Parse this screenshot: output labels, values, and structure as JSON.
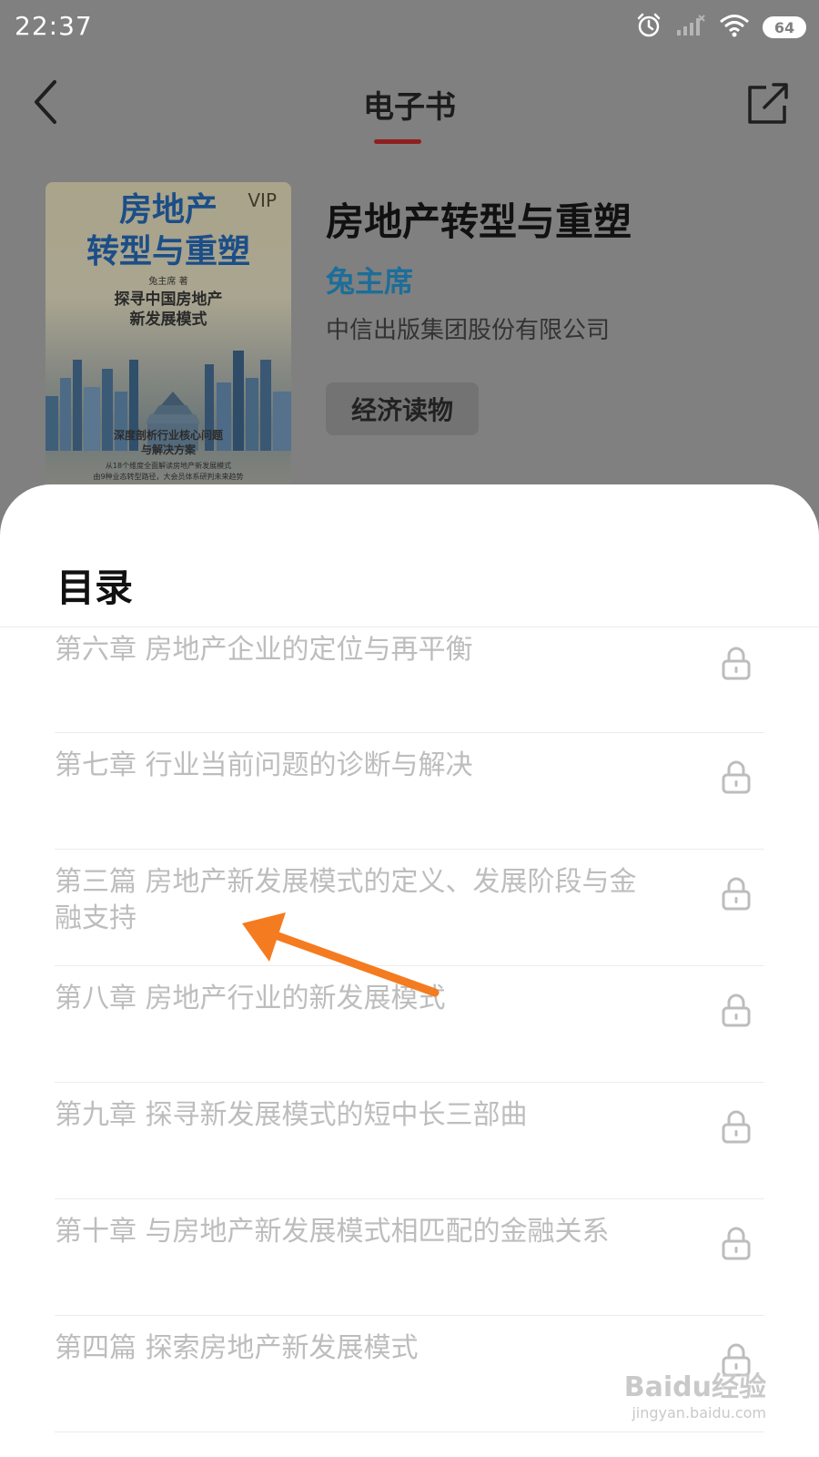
{
  "status_bar": {
    "time": "22:37",
    "battery": "64",
    "icons": [
      "alarm-icon",
      "signal-icon",
      "wifi-icon",
      "battery-icon"
    ]
  },
  "header": {
    "title": "电子书",
    "back_icon": "back-chevron-icon",
    "share_icon": "share-icon",
    "accent_color": "#c62828"
  },
  "book": {
    "cover": {
      "vip": "VIP",
      "title_line1": "房地产",
      "title_line2": "转型与重塑",
      "author": "兔主席 著",
      "subtitle_line1": "探寻中国房地产",
      "subtitle_line2": "新发展模式",
      "note_line1": "深度剖析行业核心问题",
      "note_line2": "与解决方案",
      "note_line3": "从18个维度全面解读房地产新发展模式",
      "note_line4": "由9种业态转型路径，大会员体系研判未来趋势"
    },
    "title": "房地产转型与重塑",
    "author": "兔主席",
    "publisher": "中信出版集团股份有限公司",
    "tag": "经济读物"
  },
  "toc": {
    "title": "目录",
    "items": [
      {
        "label": "第六章 房地产企业的定位与再平衡",
        "locked": true
      },
      {
        "label": "第七章 行业当前问题的诊断与解决",
        "locked": true
      },
      {
        "label": "第三篇 房地产新发展模式的定义、发展阶段与金融支持",
        "locked": true
      },
      {
        "label": "第八章 房地产行业的新发展模式",
        "locked": true
      },
      {
        "label": "第九章 探寻新发展模式的短中长三部曲",
        "locked": true
      },
      {
        "label": "第十章 与房地产新发展模式相匹配的金融关系",
        "locked": true
      },
      {
        "label": "第四篇 探索房地产新发展模式",
        "locked": true
      }
    ]
  },
  "annotation": {
    "type": "arrow",
    "color": "#f47b20"
  },
  "watermark": {
    "brand": "Baidu经验",
    "url": "jingyan.baidu.com"
  }
}
